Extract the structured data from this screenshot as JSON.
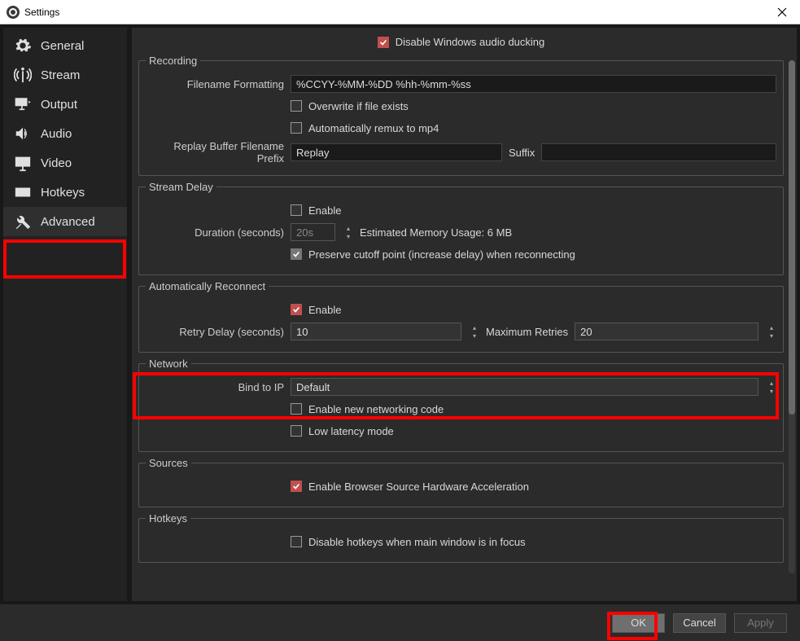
{
  "window": {
    "title": "Settings"
  },
  "sidebar": {
    "items": [
      {
        "label": "General"
      },
      {
        "label": "Stream"
      },
      {
        "label": "Output"
      },
      {
        "label": "Audio"
      },
      {
        "label": "Video"
      },
      {
        "label": "Hotkeys"
      },
      {
        "label": "Advanced"
      }
    ]
  },
  "top_checkbox": {
    "label": "Disable Windows audio ducking"
  },
  "recording": {
    "legend": "Recording",
    "filename_label": "Filename Formatting",
    "filename_value": "%CCYY-%MM-%DD %hh-%mm-%ss",
    "overwrite_label": "Overwrite if file exists",
    "remux_label": "Automatically remux to mp4",
    "replay_prefix_label": "Replay Buffer Filename Prefix",
    "replay_prefix_value": "Replay",
    "suffix_label": "Suffix"
  },
  "stream_delay": {
    "legend": "Stream Delay",
    "enable_label": "Enable",
    "duration_label": "Duration (seconds)",
    "duration_value": "20s",
    "memory_label": "Estimated Memory Usage: 6 MB",
    "preserve_label": "Preserve cutoff point (increase delay) when reconnecting"
  },
  "auto_reconnect": {
    "legend": "Automatically Reconnect",
    "enable_label": "Enable",
    "retry_label": "Retry Delay (seconds)",
    "retry_value": "10",
    "max_label": "Maximum Retries",
    "max_value": "20"
  },
  "network": {
    "legend": "Network",
    "bind_label": "Bind to IP",
    "bind_value": "Default",
    "new_net_label": "Enable new networking code",
    "low_lat_label": "Low latency mode"
  },
  "sources": {
    "legend": "Sources",
    "browser_hw_label": "Enable Browser Source Hardware Acceleration"
  },
  "hotkeys": {
    "legend": "Hotkeys",
    "disable_label": "Disable hotkeys when main window is in focus"
  },
  "footer": {
    "ok": "OK",
    "cancel": "Cancel",
    "apply": "Apply"
  }
}
